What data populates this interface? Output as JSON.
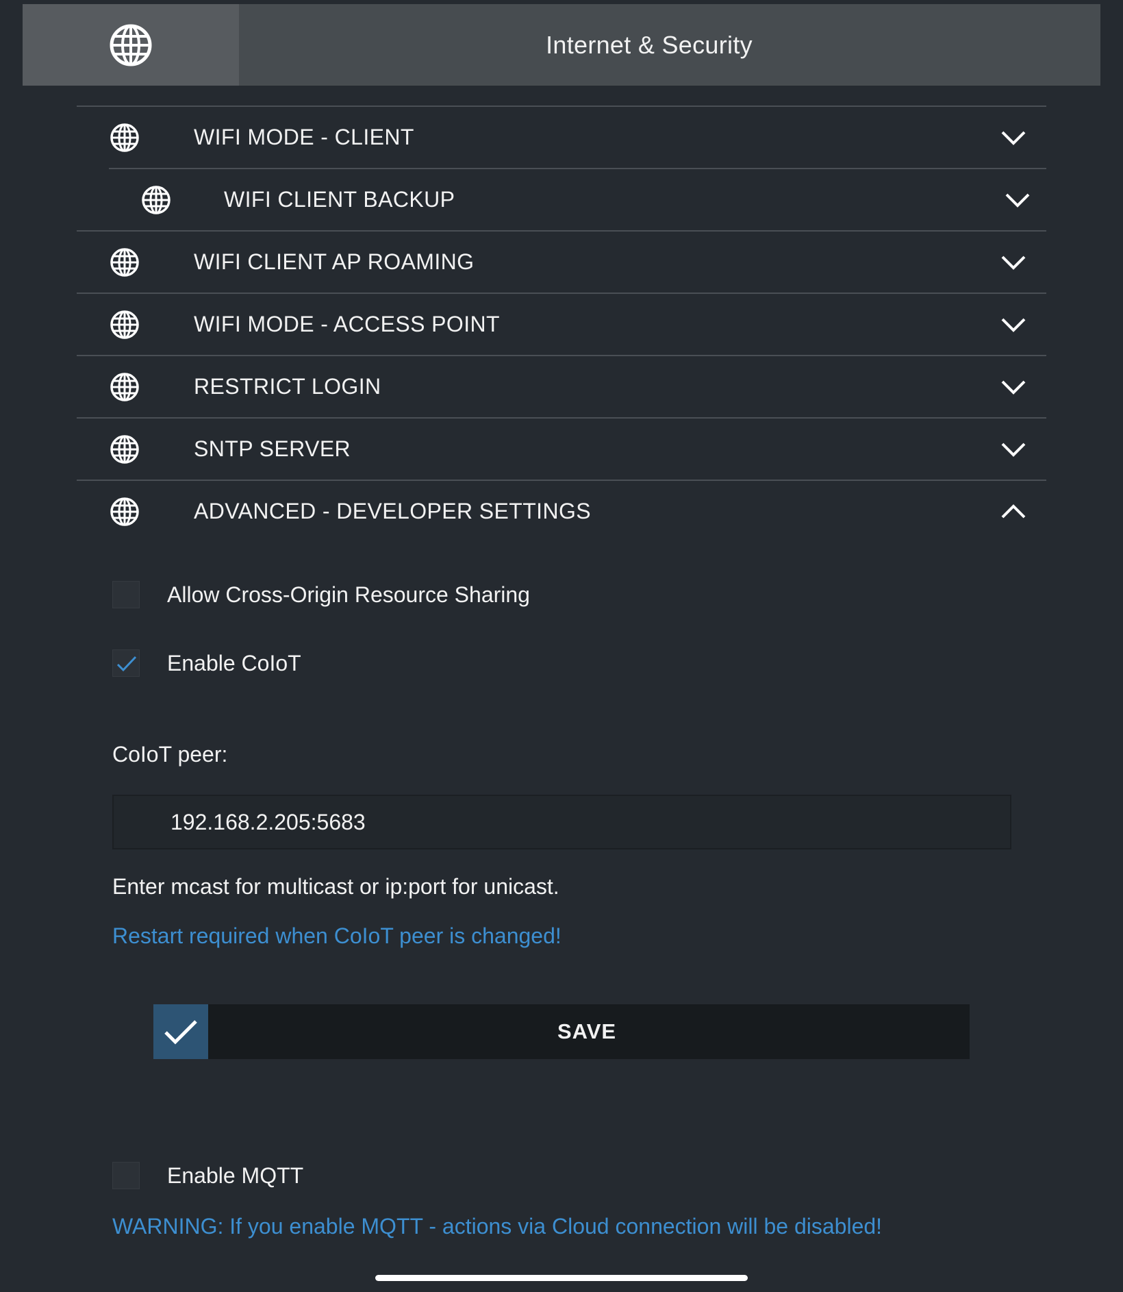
{
  "header": {
    "title": "Internet & Security",
    "icon": "globe-icon"
  },
  "sections": [
    {
      "label": "WIFI MODE - CLIENT",
      "expanded": false
    },
    {
      "label": "WIFI CLIENT BACKUP",
      "expanded": false,
      "sub": true
    },
    {
      "label": "WIFI CLIENT AP ROAMING",
      "expanded": false
    },
    {
      "label": "WIFI MODE - ACCESS POINT",
      "expanded": false
    },
    {
      "label": "RESTRICT LOGIN",
      "expanded": false
    },
    {
      "label": "SNTP SERVER",
      "expanded": false
    },
    {
      "label": "ADVANCED - DEVELOPER SETTINGS",
      "expanded": true
    }
  ],
  "advanced": {
    "cors": {
      "label": "Allow Cross-Origin Resource Sharing",
      "checked": false
    },
    "coiot": {
      "label": "Enable CoIoT",
      "checked": true
    },
    "peer_label": "CoIoT peer:",
    "peer_value": "192.168.2.205:5683",
    "peer_hint": "Enter mcast for multicast or ip:port for unicast.",
    "restart_warning": "Restart required when CoIoT peer is changed!",
    "save_label": "SAVE",
    "mqtt": {
      "label": "Enable MQTT",
      "checked": false
    },
    "mqtt_warning": "WARNING: If you enable MQTT - actions via Cloud connection will be disabled!"
  },
  "colors": {
    "background": "#252a30",
    "header": "#474c50",
    "accent_blue": "#3d8fd1",
    "save_check": "#2d5474"
  }
}
